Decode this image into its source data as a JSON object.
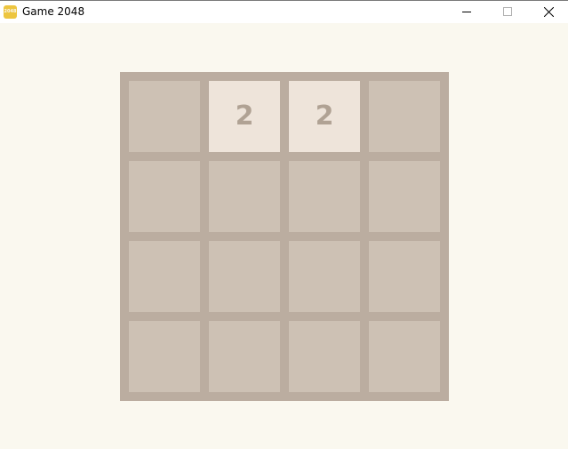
{
  "window": {
    "title": "Game 2048",
    "icon_label": "2048",
    "controls": [
      "minimize-icon",
      "maximize-icon",
      "close-icon"
    ]
  },
  "board": {
    "size": 4,
    "tiles": [
      {
        "row": 0,
        "col": 1,
        "value": "2"
      },
      {
        "row": 0,
        "col": 2,
        "value": "2"
      }
    ]
  },
  "colors": {
    "background": "#faf8ef",
    "board": "#bbada0",
    "empty_cell": "#cdc1b4",
    "tile_2": "#eee4da",
    "tile_text": "#b0a294"
  }
}
